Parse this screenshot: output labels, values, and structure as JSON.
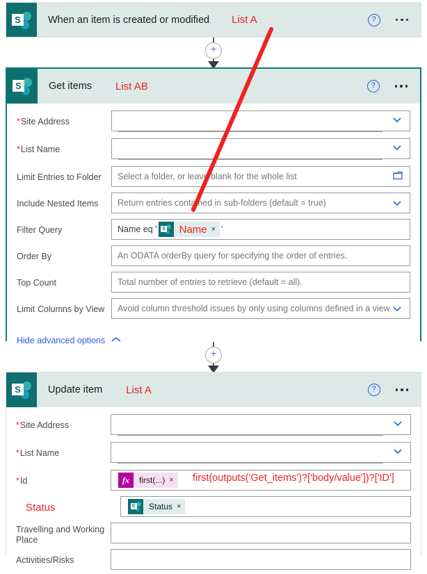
{
  "flow": {
    "trigger": {
      "title": "When an item is created or modified",
      "annotation": "List A",
      "icon": "sharepoint-icon",
      "help_icon": "?",
      "menu_icon": "ellipsis-icon"
    },
    "get_items": {
      "title": "Get items",
      "annotation": "List AB",
      "icon": "sharepoint-icon",
      "help_icon": "?",
      "menu_icon": "ellipsis-icon",
      "fields": [
        {
          "label": "Site Address",
          "required": true,
          "type": "combo",
          "value": "",
          "placeholder": ""
        },
        {
          "label": "List Name",
          "required": true,
          "type": "combo",
          "value": "",
          "placeholder": ""
        },
        {
          "label": "Limit Entries to Folder",
          "required": false,
          "type": "folder",
          "value": "",
          "placeholder": "Select a folder, or leave blank for the whole list"
        },
        {
          "label": "Include Nested Items",
          "required": false,
          "type": "dropdown",
          "value": "",
          "placeholder": "Return entries contained in sub-folders (default = true)"
        },
        {
          "label": "Filter Query",
          "required": false,
          "type": "token",
          "value": "",
          "placeholder": ""
        },
        {
          "label": "Order By",
          "required": false,
          "type": "text",
          "value": "",
          "placeholder": "An ODATA orderBy query for specifying the order of entries."
        },
        {
          "label": "Top Count",
          "required": false,
          "type": "text",
          "value": "",
          "placeholder": "Total number of entries to retrieve (default = all)."
        },
        {
          "label": "Limit Columns by View",
          "required": false,
          "type": "dropdown",
          "value": "",
          "placeholder": "Avoid column threshold issues by only using columns defined in a view"
        }
      ],
      "filter_query": {
        "prefix": "Name eq '",
        "token_label": "Name",
        "token_icon": "sharepoint-icon",
        "token_close": "×",
        "suffix": "'"
      },
      "advanced_link": "Hide advanced options",
      "advanced_caret": "caret-up-icon"
    },
    "update_item": {
      "title": "Update item",
      "annotation": "List A",
      "icon": "sharepoint-icon",
      "help_icon": "?",
      "menu_icon": "ellipsis-icon",
      "fields": [
        {
          "label": "Site Address",
          "required": true,
          "type": "combo",
          "value": "",
          "placeholder": ""
        },
        {
          "label": "List Name",
          "required": true,
          "type": "combo",
          "value": "",
          "placeholder": ""
        },
        {
          "label": "Id",
          "required": true,
          "type": "expression",
          "value": "",
          "placeholder": ""
        },
        {
          "label": "Status",
          "required": false,
          "type": "token",
          "value": "",
          "placeholder": "",
          "label_is_annotation": true
        },
        {
          "label": "Travelling and Working Place",
          "required": false,
          "type": "text",
          "value": "",
          "placeholder": ""
        },
        {
          "label": "Activities/Risks",
          "required": false,
          "type": "text",
          "value": "",
          "placeholder": ""
        }
      ],
      "id_field": {
        "token_icon": "fx-icon",
        "token_icon_label": "fx",
        "token_label": "first(...)",
        "token_close": "×",
        "annotation": "first(outputs('Get_items')?['body/value'])?['ID']"
      },
      "status_field": {
        "token_icon": "sharepoint-icon",
        "token_label": "Status",
        "token_close": "×"
      }
    },
    "connector": {
      "add_icon": "+",
      "arrow_icon": "arrow-down-icon"
    },
    "annotation_arrow": {
      "name": "red-arrow-annotation",
      "color": "#ee2222"
    }
  },
  "colors": {
    "sharepoint_teal": "#0f6e6e",
    "header_bg": "#dce9e7",
    "selected_border": "#0b7b7b",
    "annotation_red": "#ee2222",
    "link_blue": "#2b5fd9",
    "fx_magenta": "#b4009e"
  }
}
